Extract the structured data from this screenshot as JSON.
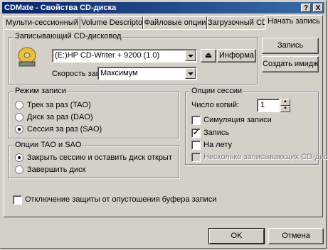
{
  "window": {
    "title": "CDMate - Свойства CD-диска"
  },
  "titlebar": {
    "help": "?",
    "close": "X"
  },
  "tabs": [
    "Мульти-сессионный",
    "Volume Descriptor",
    "Файловые опции",
    "Загрузочный CD",
    "Начать запись"
  ],
  "recorder_group": {
    "legend": "Записывающий CD-дисковод",
    "drive": "(E:)HP CD-Writer + 9200 (1.0)",
    "eject_symbol": "⏏",
    "info_button": "Информа",
    "speed_label": "Скорость запис",
    "speed": "Максимум",
    "disc_icon": "cd-drive-icon"
  },
  "actions": {
    "write": "Запись",
    "create_image": "Создать имидж"
  },
  "mode_group": {
    "legend": "Режим записи",
    "options": [
      "Трек за раз (TAO)",
      "Диск за раз (DAO)",
      "Сессия за раз (SAO)"
    ],
    "selected": 2
  },
  "tao_group": {
    "legend": "Опции TAO и SAO",
    "options": [
      "Закрыть сессию и оставить диск открыт",
      "Завершить диск"
    ],
    "selected": 0
  },
  "session_group": {
    "legend": "Опции сессии",
    "copies_label": "Число копий:",
    "copies": "1",
    "simulate": "Симуляция записи",
    "write": "Запись",
    "on_the_fly": "На лету",
    "multi_writer": "Несколько записывающих CD-диск"
  },
  "buffer_protection": "Отключение защиты от опустошения буфера записи",
  "footer": {
    "ok": "OK",
    "cancel": "Отмена"
  }
}
